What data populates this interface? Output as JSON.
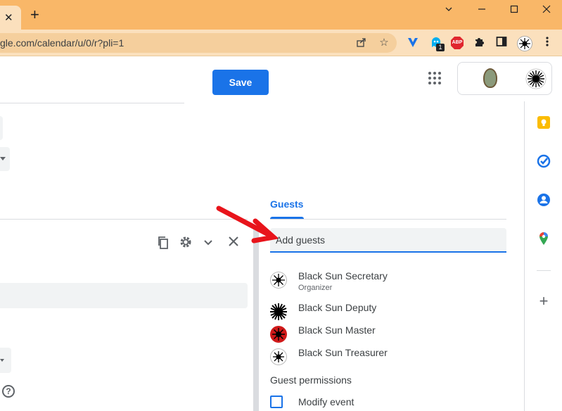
{
  "browser": {
    "tab_close_glyph": "✕",
    "new_tab_glyph": "+",
    "url": "gle.com/calendar/u/0/r?pli=1",
    "window_controls": [
      "minimize-icon",
      "maximize-icon",
      "close-icon"
    ],
    "extensions": [
      "share-icon",
      "star-icon",
      "vpn-icon",
      "ghostery-icon",
      "abp-icon",
      "puzzle-icon",
      "sidepanel-icon",
      "profile-icon",
      "more-icon"
    ],
    "abp_label": "ABP",
    "ghost_badge": "1",
    "colors": {
      "tabstrip": "#f9b768",
      "toolbar": "#fbe0bd"
    }
  },
  "header": {
    "save_label": "Save"
  },
  "guests": {
    "tab_label": "Guests",
    "add_placeholder": "Add guests",
    "list": [
      {
        "name": "Black Sun Secretary",
        "role": "Organizer",
        "avatar": "sun-outline"
      },
      {
        "name": "Black Sun Deputy",
        "role": "",
        "avatar": "sun-black"
      },
      {
        "name": "Black Sun Master",
        "role": "",
        "avatar": "sun-red"
      },
      {
        "name": "Black Sun Treasurer",
        "role": "",
        "avatar": "sun-outline"
      }
    ]
  },
  "permissions": {
    "title": "Guest permissions",
    "items": [
      {
        "label": "Modify event",
        "checked": false
      }
    ]
  },
  "side_panel": {
    "icons": [
      "keep-icon",
      "tasks-icon",
      "contacts-icon",
      "maps-icon"
    ],
    "add_glyph": "+"
  },
  "colors": {
    "accent": "#1a73e8",
    "annotation_arrow": "#e8141b"
  }
}
